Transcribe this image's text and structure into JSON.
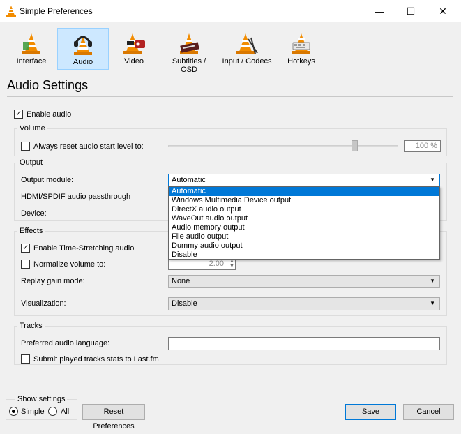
{
  "window": {
    "title": "Simple Preferences",
    "minimize_icon": "—",
    "maximize_icon": "☐",
    "close_icon": "✕"
  },
  "toolbar": {
    "items": [
      {
        "label": "Interface",
        "icon": "cone-interface-icon"
      },
      {
        "label": "Audio",
        "icon": "cone-headphones-icon"
      },
      {
        "label": "Video",
        "icon": "cone-video-icon"
      },
      {
        "label": "Subtitles / OSD",
        "icon": "cone-subtitles-icon"
      },
      {
        "label": "Input / Codecs",
        "icon": "cone-codecs-icon"
      },
      {
        "label": "Hotkeys",
        "icon": "cone-hotkeys-icon"
      }
    ],
    "active": "Audio"
  },
  "page_title": "Audio Settings",
  "enable_audio": {
    "label": "Enable audio",
    "checked": true
  },
  "volume": {
    "title": "Volume",
    "reset_label": "Always reset audio start level to:",
    "reset_checked": false,
    "level_percent": 100,
    "level_text": "100 %"
  },
  "output": {
    "title": "Output",
    "module_label": "Output module:",
    "module_value": "Automatic",
    "passthrough_label": "HDMI/SPDIF audio passthrough",
    "device_label": "Device:",
    "dropdown_options": [
      "Automatic",
      "Windows Multimedia Device output",
      "DirectX audio output",
      "WaveOut audio output",
      "Audio memory output",
      "File audio output",
      "Dummy audio output",
      "Disable"
    ],
    "dropdown_selected": "Automatic"
  },
  "effects": {
    "title": "Effects",
    "time_stretching_label": "Enable Time-Stretching audio",
    "time_stretching_checked": true,
    "normalize_label": "Normalize volume to:",
    "normalize_checked": false,
    "normalize_value": "2.00",
    "replay_gain_label": "Replay gain mode:",
    "replay_gain_value": "None",
    "visualization_label": "Visualization:",
    "visualization_value": "Disable"
  },
  "tracks": {
    "title": "Tracks",
    "language_label": "Preferred audio language:",
    "language_value": "",
    "lastfm_label": "Submit played tracks stats to Last.fm",
    "lastfm_checked": false
  },
  "footer": {
    "show_settings_label": "Show settings",
    "simple_label": "Simple",
    "all_label": "All",
    "selected": "Simple",
    "reset_button": "Reset Preferences",
    "save_button": "Save",
    "cancel_button": "Cancel"
  },
  "colors": {
    "accent": "#0078d7",
    "cone_orange": "#f28c00",
    "active_tab_bg": "#cde8ff"
  }
}
